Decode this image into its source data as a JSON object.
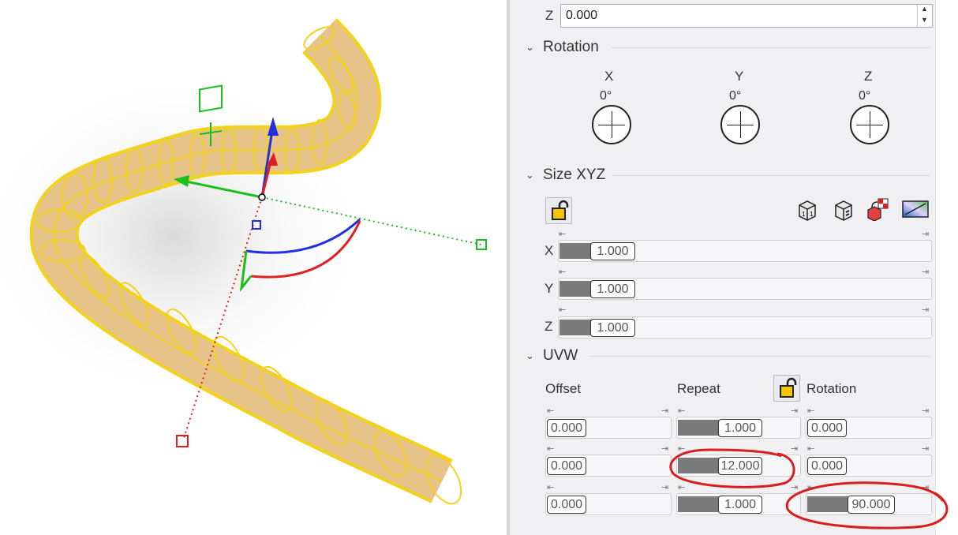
{
  "position": {
    "z_label": "Z",
    "z_value": "0.000"
  },
  "rotation": {
    "title": "Rotation",
    "axes": [
      {
        "label": "X",
        "value": "0°"
      },
      {
        "label": "Y",
        "value": "0°"
      },
      {
        "label": "Z",
        "value": "0°"
      }
    ]
  },
  "size": {
    "title": "Size XYZ",
    "rows": [
      {
        "label": "X",
        "value": "1.000"
      },
      {
        "label": "Y",
        "value": "1.000"
      },
      {
        "label": "Z",
        "value": "1.000"
      }
    ]
  },
  "uvw": {
    "title": "UVW",
    "headers": {
      "offset": "Offset",
      "repeat": "Repeat",
      "rotation": "Rotation"
    },
    "offset": [
      "0.000",
      "0.000",
      "0.000"
    ],
    "repeat": [
      "1.000",
      "12.000",
      "1.000"
    ],
    "rotation": [
      "0.000",
      "0.000",
      "90.000"
    ]
  },
  "icons": [
    "lock-icon",
    "box-one-icon",
    "box-dice-icon",
    "box-checker-icon",
    "gradient-swatch-icon"
  ],
  "colors": {
    "tube_outline": "#f2d21a",
    "tube_fill": "#e6c489",
    "annotation": "#d81f1f",
    "x_axis": "#e02020",
    "y_axis": "#19c01a",
    "z_axis": "#2030e0"
  }
}
